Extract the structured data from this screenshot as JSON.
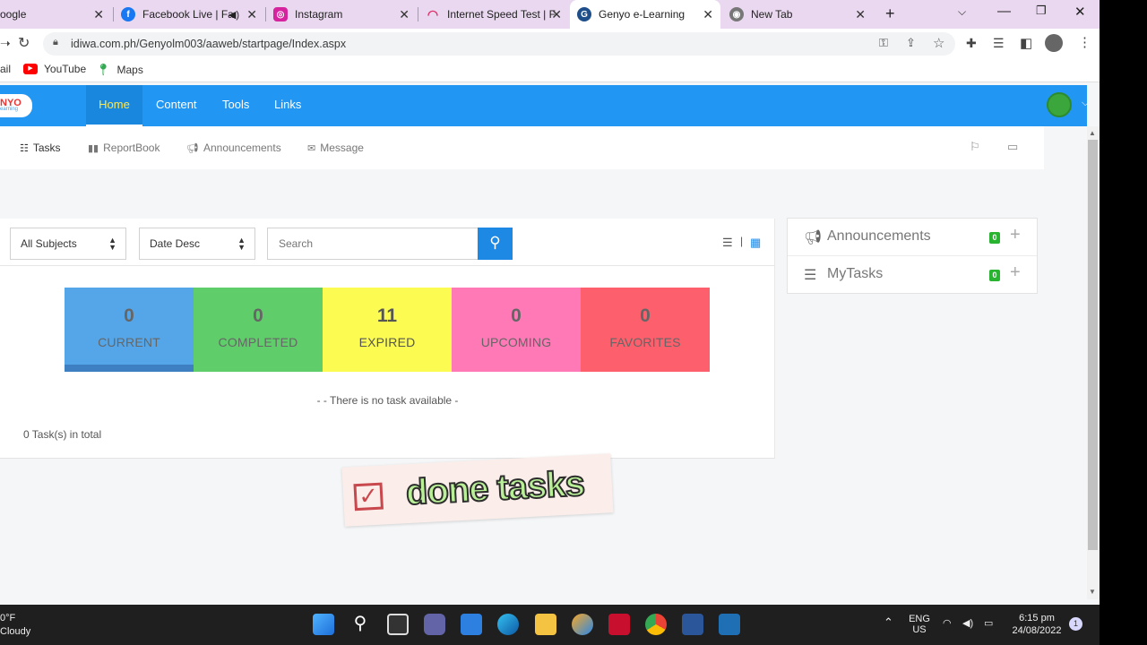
{
  "browser": {
    "tabs": [
      {
        "title": "oogle",
        "icon": "google-icon"
      },
      {
        "title": "Facebook Live | Fa",
        "icon": "facebook-icon"
      },
      {
        "title": "Instagram",
        "icon": "instagram-icon"
      },
      {
        "title": "Internet Speed Test | F",
        "icon": "speedtest-icon"
      },
      {
        "title": "Genyo e-Learning",
        "icon": "genyo-icon",
        "active": true
      },
      {
        "title": "New Tab",
        "icon": "chrome-icon"
      }
    ],
    "url": "idiwa.com.ph/Genyolm003/aaweb/startpage/Index.aspx",
    "bookmarks": [
      {
        "label": "ail"
      },
      {
        "label": "YouTube"
      },
      {
        "label": "Maps"
      }
    ]
  },
  "app": {
    "logo_text": "NYO",
    "logo_sub": "earning",
    "nav": [
      {
        "label": "Home",
        "active": true
      },
      {
        "label": "Content"
      },
      {
        "label": "Tools"
      },
      {
        "label": "Links"
      }
    ],
    "subnav": [
      {
        "label": "Tasks",
        "icon": "list-icon"
      },
      {
        "label": "ReportBook",
        "icon": "bar-chart-icon"
      },
      {
        "label": "Announcements",
        "icon": "megaphone-icon"
      },
      {
        "label": "Message",
        "icon": "envelope-icon"
      }
    ],
    "filters": {
      "subject": "All Subjects",
      "sort": "Date Desc",
      "search_placeholder": "Search"
    },
    "stats": [
      {
        "count": "0",
        "label": "CURRENT",
        "color": "#55a6e8"
      },
      {
        "count": "0",
        "label": "COMPLETED",
        "color": "#5fcd6a"
      },
      {
        "count": "11",
        "label": "EXPIRED",
        "color": "#fbfb52"
      },
      {
        "count": "0",
        "label": "UPCOMING",
        "color": "#ff79b6"
      },
      {
        "count": "0",
        "label": "FAVORITES",
        "color": "#fd5f6c"
      }
    ],
    "empty_message": "- - There is no task available -",
    "total_text": "0 Task(s) in total",
    "sidebar": [
      {
        "label": "Announcements",
        "count": "0",
        "icon": "megaphone-icon"
      },
      {
        "label": "MyTasks",
        "count": "0",
        "icon": "checklist-icon"
      }
    ]
  },
  "overlay": {
    "sticker_text": "done tasks"
  },
  "taskbar": {
    "weather_temp": "0°F",
    "weather_desc": "Cloudy",
    "lang_primary": "ENG",
    "lang_secondary": "US",
    "time": "6:15 pm",
    "date": "24/08/2022",
    "notification_count": "1"
  },
  "colors": {
    "nav_bg": "#2196f3",
    "active_nav_text": "#ffe94d",
    "search_button": "#1e88e5",
    "badge": "#28b430"
  }
}
